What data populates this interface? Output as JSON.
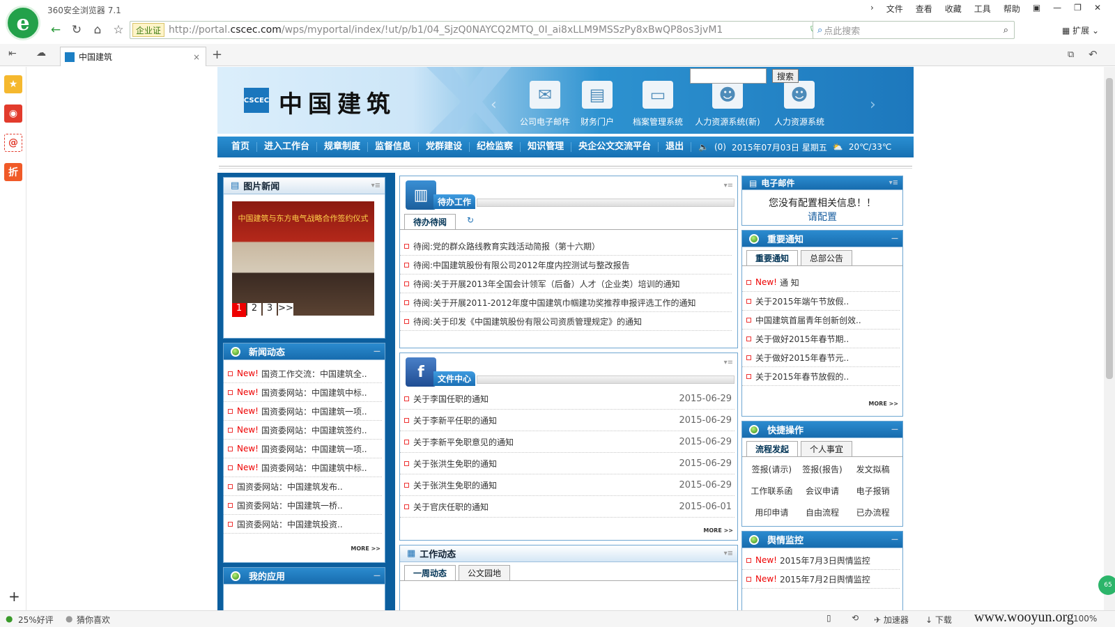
{
  "browser": {
    "title": "360安全浏览器 7.1",
    "menus": [
      "文件",
      "查看",
      "收藏",
      "工具",
      "帮助"
    ],
    "badge": "企业证",
    "url_prefix": "http://portal.",
    "url_domain": "cscec.com",
    "url_path": "/wps/myportal/index/!ut/p/b1/04_SjzQ0NAYCQ2MTQ_0I_ai8xLLM9MSSzPy8xBwQP8os3jvM1",
    "search_placeholder": "点此搜索",
    "extension_label": "扩展",
    "tab_title": "中国建筑",
    "status_left": [
      "25%好评",
      "猜你喜欢"
    ],
    "status_right": [
      "加速器",
      "下载",
      "100%"
    ],
    "watermark": "www.wooyun.org"
  },
  "portal": {
    "site_name": "中国建筑",
    "search_button": "搜索",
    "banner_links": [
      "公司电子邮件",
      "财务门户",
      "档案管理系统",
      "人力资源系统(新)",
      "人力资源系统"
    ],
    "nav": [
      "首页",
      "进入工作台",
      "规章制度",
      "监督信息",
      "党群建设",
      "纪检监察",
      "知识管理",
      "央企公文交流平台",
      "退出"
    ],
    "nav_info": {
      "count": "(0)",
      "date": "2015年07月03日 星期五",
      "weather": "20℃/33℃"
    },
    "photo_news": {
      "title": "图片新闻",
      "caption": "中国建筑与东方电气战略合作签约仪式",
      "pages": [
        "1",
        "2",
        "3",
        ">>"
      ]
    },
    "news": {
      "title": "新闻动态",
      "new_label": "New!",
      "items": [
        {
          "new": true,
          "text": "国资工作交流：中国建筑全.."
        },
        {
          "new": true,
          "text": "国资委网站：中国建筑中标.."
        },
        {
          "new": true,
          "text": "国资委网站：中国建筑一项.."
        },
        {
          "new": true,
          "text": "国资委网站：中国建筑签约.."
        },
        {
          "new": true,
          "text": "国资委网站：中国建筑一项.."
        },
        {
          "new": true,
          "text": "国资委网站：中国建筑中标.."
        },
        {
          "new": false,
          "text": "国资委网站：中国建筑发布.."
        },
        {
          "new": false,
          "text": "国资委网站：中国建筑一桥.."
        },
        {
          "new": false,
          "text": "国资委网站：中国建筑投资.."
        }
      ],
      "more": "MORE >>"
    },
    "my_apps": {
      "title": "我的应用"
    },
    "todo": {
      "title": "待办工作",
      "tab": "待办待阅",
      "items": [
        "待阅:党的群众路线教育实践活动简报（第十六期）",
        "待阅:中国建筑股份有限公司2012年度内控测试与整改报告",
        "待阅:关于开展2013年全国会计领军（后备）人才（企业类）培训的通知",
        "待阅:关于开展2011-2012年度中国建筑巾帼建功奖推荐申报评选工作的通知",
        "待阅:关于印发《中国建筑股份有限公司资质管理规定》的通知"
      ]
    },
    "files": {
      "title": "文件中心",
      "items": [
        {
          "text": "关于李国任职的通知",
          "date": "2015-06-29"
        },
        {
          "text": "关于李新平任职的通知",
          "date": "2015-06-29"
        },
        {
          "text": "关于李新平免职意见的通知",
          "date": "2015-06-29"
        },
        {
          "text": "关于张洪生免职的通知",
          "date": "2015-06-29"
        },
        {
          "text": "关于张洪生免职的通知",
          "date": "2015-06-29"
        },
        {
          "text": "关于官庆任职的通知",
          "date": "2015-06-01"
        }
      ],
      "more": "MORE >>"
    },
    "work": {
      "title": "工作动态",
      "tabs": [
        "一周动态",
        "公文园地"
      ]
    },
    "email": {
      "title": "电子邮件",
      "msg": "您没有配置相关信息！！",
      "link": "请配置"
    },
    "notices": {
      "title": "重要通知",
      "tabs": [
        "重要通知",
        "总部公告"
      ],
      "items": [
        {
          "new": true,
          "text": "通  知"
        },
        {
          "new": false,
          "text": "关于2015年端午节放假.."
        },
        {
          "new": false,
          "text": "中国建筑首届青年创新创效.."
        },
        {
          "new": false,
          "text": "关于做好2015年春节期.."
        },
        {
          "new": false,
          "text": "关于做好2015年春节元.."
        },
        {
          "new": false,
          "text": "关于2015年春节放假的.."
        }
      ],
      "more": "MORE >>"
    },
    "quick": {
      "title": "快捷操作",
      "tabs": [
        "流程发起",
        "个人事宜"
      ],
      "items": [
        "签报(请示)",
        "签报(报告)",
        "发文拟稿",
        "工作联系函",
        "会议申请",
        "电子报销",
        "用印申请",
        "自由流程",
        "已办流程"
      ]
    },
    "opinion": {
      "title": "舆情监控",
      "items": [
        {
          "new": true,
          "text": "2015年7月3日舆情监控"
        },
        {
          "new": true,
          "text": "2015年7月2日舆情监控"
        }
      ]
    }
  }
}
